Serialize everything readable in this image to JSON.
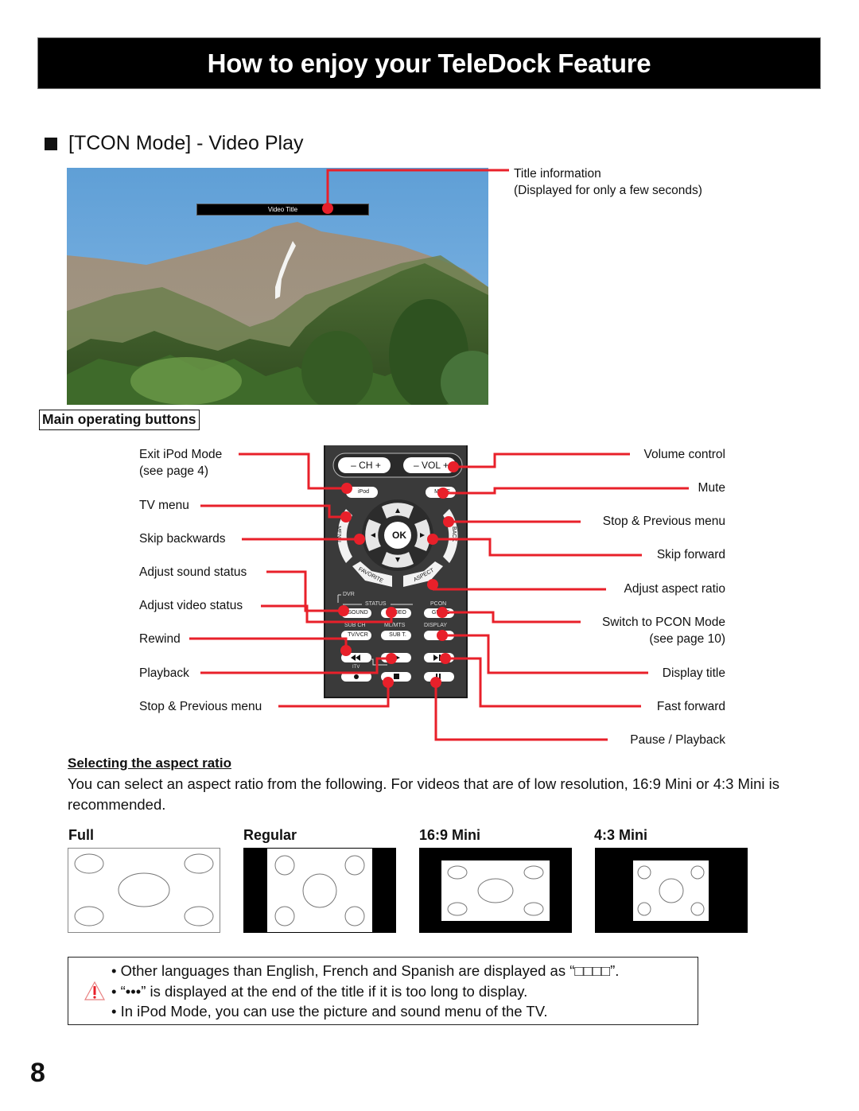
{
  "page": {
    "title": "How to enjoy your TeleDock Feature",
    "section_heading": "[TCON Mode] - Video Play",
    "page_number": "8"
  },
  "video_screen": {
    "overlay_title": "Video Title",
    "callout_line1": "Title information",
    "callout_line2": "(Displayed for only a few seconds)"
  },
  "main_operating_buttons": {
    "heading": "Main operating buttons",
    "left_callouts": [
      {
        "label": "Exit iPod Mode",
        "sub": "(see page 4)"
      },
      {
        "label": "TV menu"
      },
      {
        "label": "Skip backwards"
      },
      {
        "label": "Adjust sound status"
      },
      {
        "label": "Adjust video status"
      },
      {
        "label": "Rewind"
      },
      {
        "label": "Playback"
      },
      {
        "label": "Stop & Previous menu"
      }
    ],
    "right_callouts": [
      {
        "label": "Volume control"
      },
      {
        "label": "Mute"
      },
      {
        "label": "Stop & Previous menu"
      },
      {
        "label": "Skip forward"
      },
      {
        "label": "Adjust aspect ratio"
      },
      {
        "label": "Switch to PCON Mode",
        "sub": "(see page 10)"
      },
      {
        "label": "Display title"
      },
      {
        "label": "Fast forward"
      },
      {
        "label": "Pause / Playback"
      }
    ],
    "remote": {
      "ch": "– CH +",
      "vol": "– VOL +",
      "ipod": "iPod",
      "mute": "MUTE",
      "menu": "MENU",
      "back": "BACK",
      "ok": "OK",
      "favorite": "FAVORITE",
      "aspect": "ASPECT",
      "dvr": "DVR",
      "status": "STATUS",
      "pcon": "PCON",
      "sound": "SOUND",
      "video": "VIDEO",
      "guide": "GUIDE",
      "sub_ch": "SUB CH",
      "ml_mts": "ML/MTS",
      "display": "DISPLAY",
      "tv_vcr": "TV/VCR",
      "sub_t": "SUB T.",
      "itv": "ITV"
    }
  },
  "aspect_ratio": {
    "heading": "Selecting the aspect ratio",
    "paragraph": "You can select an aspect ratio from the following.  For videos that are of low resolution, 16:9 Mini or 4:3 Mini is recommended.",
    "modes": [
      {
        "label": "Full"
      },
      {
        "label": "Regular"
      },
      {
        "label": "16:9 Mini"
      },
      {
        "label": "4:3 Mini"
      }
    ]
  },
  "notes": [
    "•  Other languages than English, French and Spanish are displayed as “□□□□”.",
    "•  “•••” is displayed at the end of the title if it is too long to display.",
    "•  In iPod Mode, you can use the picture and sound menu of the TV."
  ],
  "colors": {
    "callout_red": "#e8202a",
    "banner_bg": "#000000",
    "remote_body": "#3a3a3a"
  }
}
